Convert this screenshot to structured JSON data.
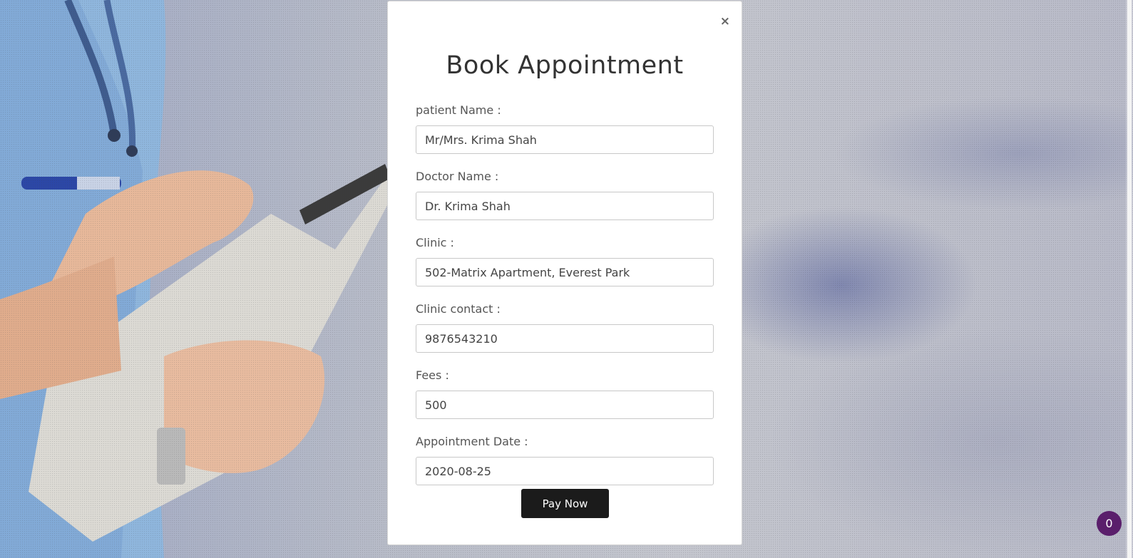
{
  "modal": {
    "title": "Book Appointment",
    "close_label": "×",
    "fields": [
      {
        "label": "patient Name :",
        "value": "Mr/Mrs. Krima Shah"
      },
      {
        "label": "Doctor Name :",
        "value": "Dr. Krima Shah"
      },
      {
        "label": "Clinic :",
        "value": "502-Matrix Apartment, Everest Park"
      },
      {
        "label": "Clinic contact :",
        "value": "9876543210"
      },
      {
        "label": "Fees :",
        "value": "500"
      },
      {
        "label": "Appointment Date :",
        "value": "2020-08-25"
      }
    ],
    "submit_label": "Pay Now"
  },
  "chat_badge": {
    "count": "0",
    "color": "#5a1e6b"
  },
  "background": {
    "description_icon": "doctor-with-clipboard-image"
  }
}
